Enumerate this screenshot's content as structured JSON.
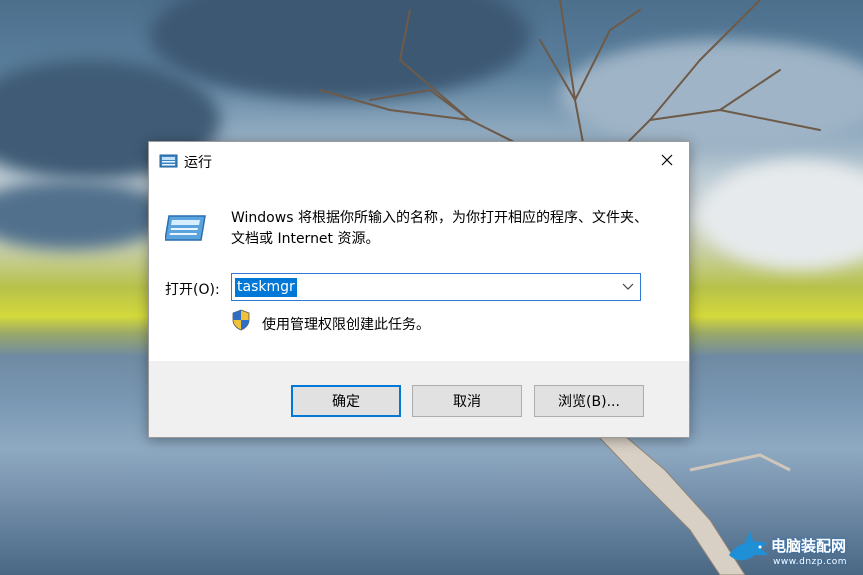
{
  "dialog": {
    "title": "运行",
    "description": "Windows 将根据你所输入的名称，为你打开相应的程序、文件夹、文档或 Internet 资源。",
    "open_label": "打开(O):",
    "input_value": "taskmgr",
    "admin_note": "使用管理权限创建此任务。",
    "buttons": {
      "ok": "确定",
      "cancel": "取消",
      "browse": "浏览(B)..."
    }
  },
  "watermark": {
    "text": "电脑装配网",
    "url": "www.dnzp.com"
  },
  "colors": {
    "accent": "#0078d7",
    "footer": "#f0f0f0"
  },
  "icons": [
    "run-app-icon",
    "close-icon",
    "chevron-down-icon",
    "uac-shield-icon"
  ]
}
